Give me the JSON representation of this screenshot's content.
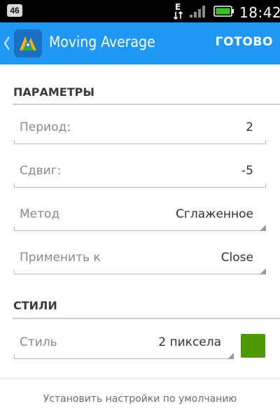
{
  "status_bar": {
    "notification_badge": "46",
    "network_type": "E",
    "clock": "18:42",
    "icons": [
      "notification-badge",
      "network-e-icon",
      "signal-icon",
      "battery-icon"
    ]
  },
  "action_bar": {
    "title": "Moving Average",
    "done_label": "ГОТОВО",
    "color": "#1f97f3",
    "icons": [
      "back-chevron-icon",
      "metatrader-logo"
    ]
  },
  "parameters": {
    "header": "ПАРАМЕТРЫ",
    "rows": [
      {
        "label": "Период:",
        "value": "2",
        "type": "input"
      },
      {
        "label": "Сдвиг:",
        "value": "-5",
        "type": "input"
      },
      {
        "label": "Метод",
        "value": "Сглаженное",
        "type": "spinner"
      },
      {
        "label": "Применить к",
        "value": "Close",
        "type": "spinner"
      }
    ]
  },
  "styles": {
    "header": "СТИЛИ",
    "style_row": {
      "label": "Стиль",
      "value": "2 пиксела",
      "type": "spinner"
    },
    "line_color": "#4f9a00"
  },
  "reset_label": "Установить настройки по умолчанию"
}
